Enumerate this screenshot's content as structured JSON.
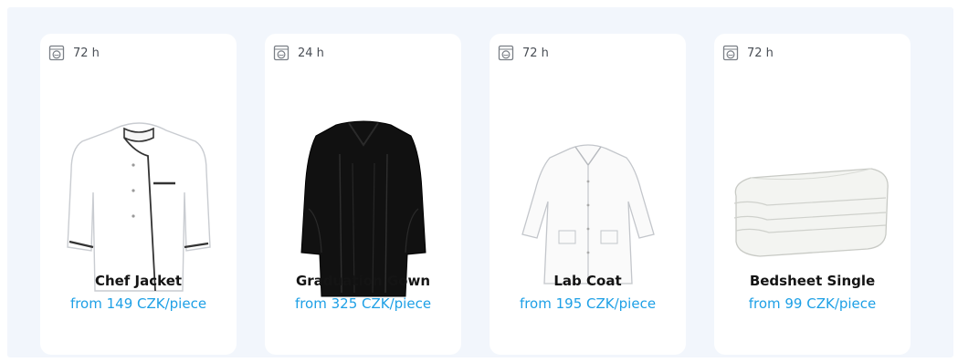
{
  "products": [
    {
      "turnaround": "72 h",
      "name": "Chef Jacket",
      "price": "from 149 CZK/piece",
      "image_icon": "chef-jacket-image"
    },
    {
      "turnaround": "24 h",
      "name": "Graduation Gown",
      "price": "from 325 CZK/piece",
      "image_icon": "graduation-gown-image"
    },
    {
      "turnaround": "72 h",
      "name": "Lab Coat",
      "price": "from 195 CZK/piece",
      "image_icon": "lab-coat-image"
    },
    {
      "turnaround": "72 h",
      "name": "Bedsheet Single",
      "price": "from 99 CZK/piece",
      "image_icon": "bedsheet-image"
    }
  ],
  "colors": {
    "background": "#f2f6fc",
    "card": "#ffffff",
    "price": "#1ea0e6",
    "name": "#141414"
  }
}
